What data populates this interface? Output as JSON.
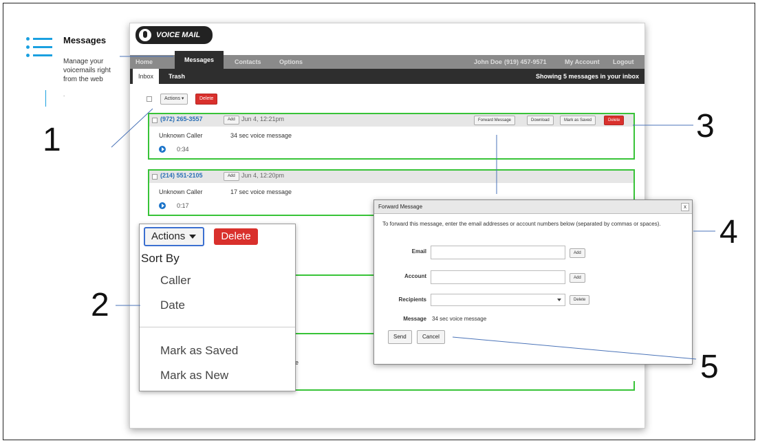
{
  "legend": {
    "title": "Messages",
    "description": "Manage your voicemails right from the web",
    "dot": "."
  },
  "callouts": [
    "1",
    "2",
    "3",
    "4",
    "5"
  ],
  "app": {
    "logo": "VOICE MAIL",
    "nav": [
      "Home",
      "Messages",
      "Contacts",
      "Options"
    ],
    "nav_active": "Messages",
    "user": "John Doe",
    "user_phone": "(919) 457-9571",
    "my_account": "My Account",
    "logout": "Logout",
    "subtabs": [
      "Inbox",
      "Trash"
    ],
    "showing": "Showing 5 messages in your inbox",
    "toolbar": {
      "actions": "Actions ▾",
      "delete": "Delete"
    }
  },
  "messages": [
    {
      "phone": "(972) 265-3557",
      "add": "Add",
      "date": "Jun 4, 12:21pm",
      "caller": "Unknown Caller",
      "description": "34 sec voice message",
      "duration": "0:34",
      "buttons": [
        "Forward Message",
        "Download",
        "Mark as Saved",
        "Delete"
      ]
    },
    {
      "phone": "(214) 551-2105",
      "add": "Add",
      "date": "Jun 4, 12:20pm",
      "caller": "Unknown Caller",
      "description": "17 sec voice message",
      "duration": "0:17"
    }
  ],
  "popup": {
    "actions": "Actions",
    "delete": "Delete",
    "sort_by": "Sort By",
    "items": [
      "Caller",
      "Date",
      "Mark as Saved",
      "Mark as New"
    ],
    "partial_text": "e"
  },
  "forward": {
    "title": "Forward Message",
    "close": "x",
    "intro": "To forward this message, enter the email addresses or account numbers below (separated by commas or spaces).",
    "email_label": "Email",
    "account_label": "Account",
    "recipients_label": "Recipients",
    "message_label": "Message",
    "message_value": "34 sec voice message",
    "add": "Add",
    "delete": "Delete",
    "send": "Send",
    "cancel": "Cancel"
  },
  "colors": {
    "accent": "#1aa0e0",
    "highlight": "#37c337",
    "danger": "#d9302c",
    "link": "#2a6fb5"
  }
}
